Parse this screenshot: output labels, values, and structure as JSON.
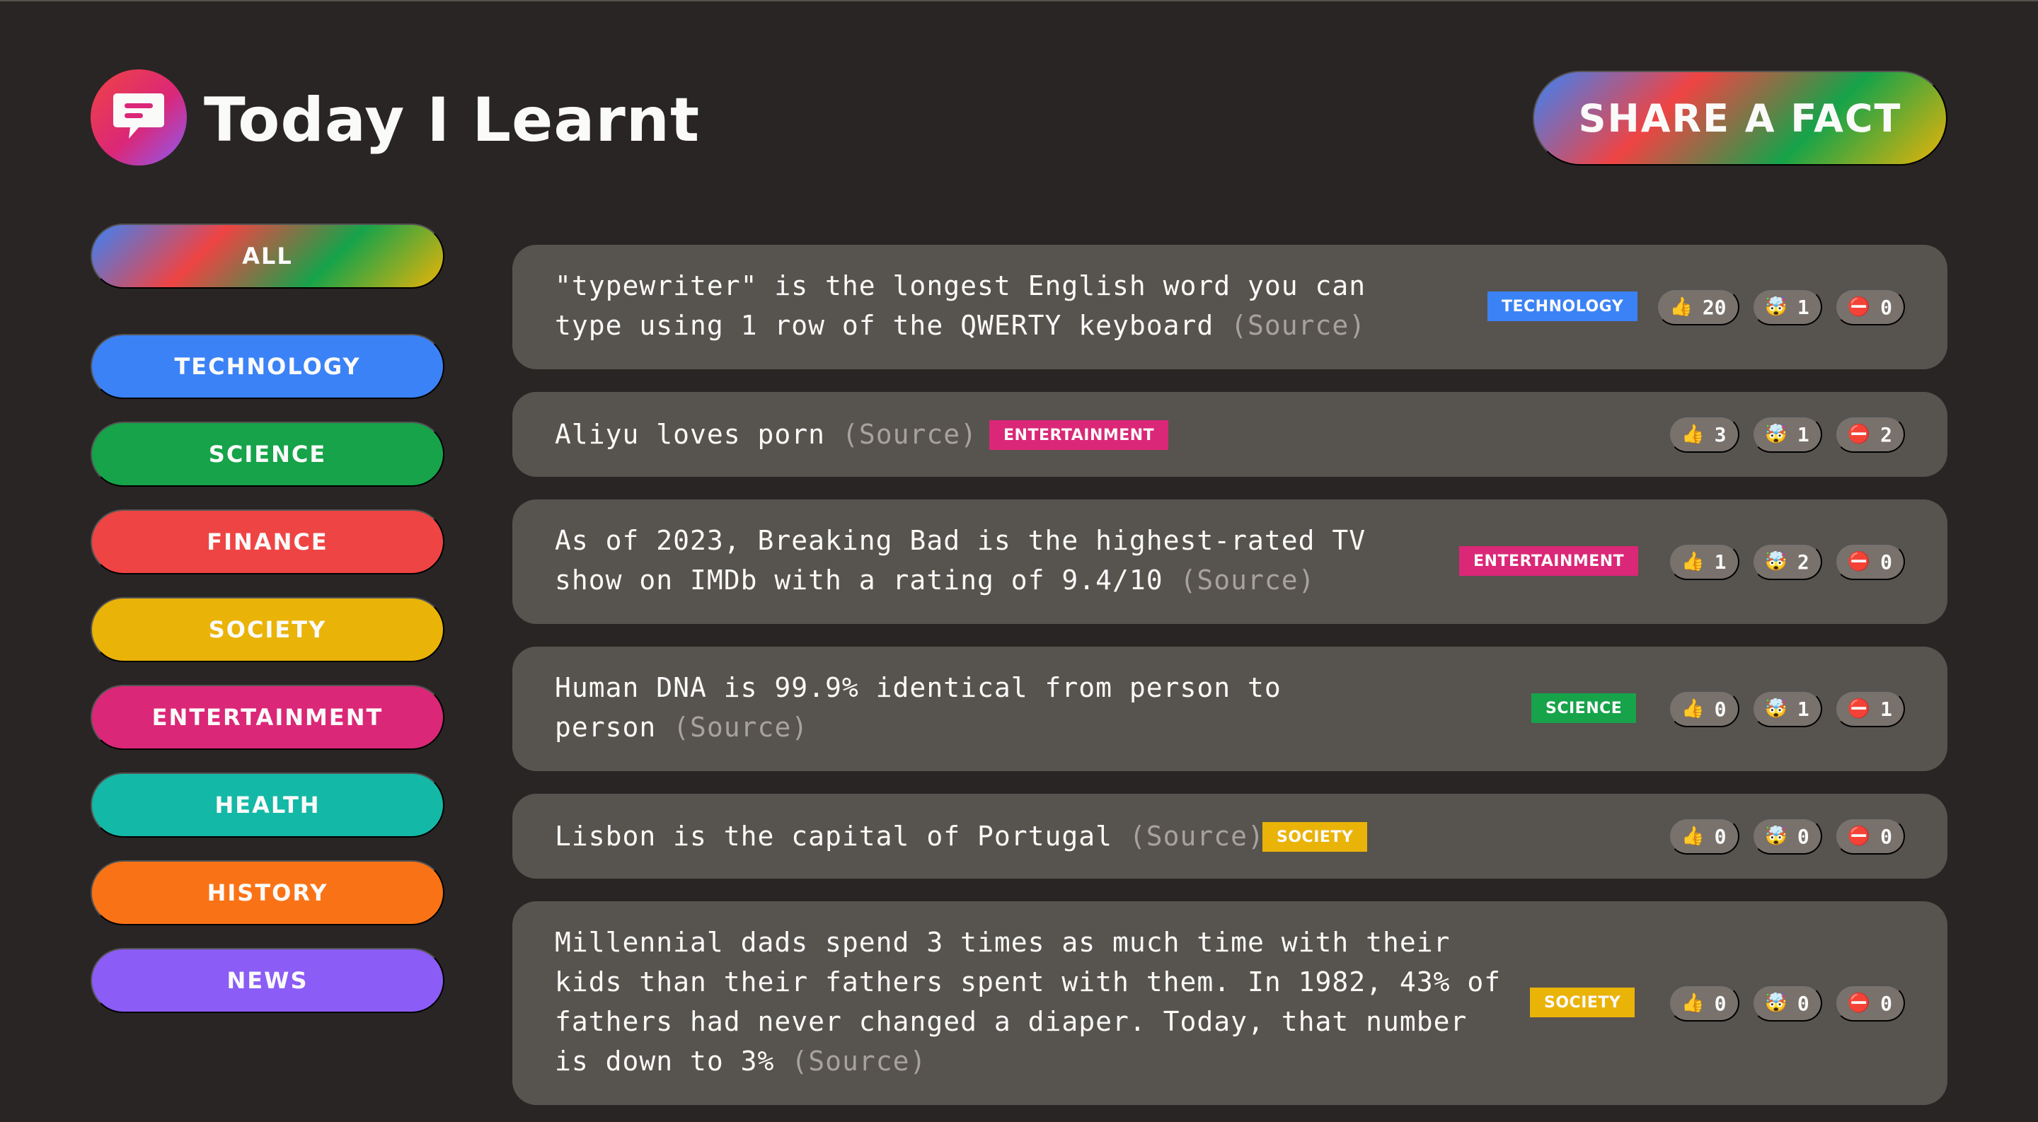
{
  "app": {
    "title": "Today I Learnt",
    "share_label": "Share a fact"
  },
  "colors": {
    "background": "#292524",
    "card": "#57534e",
    "technology": "#3b82f6",
    "science": "#16a34a",
    "finance": "#ef4444",
    "society": "#eab308",
    "entertainment": "#db2777",
    "health": "#14b8a6",
    "history": "#f97316",
    "news": "#8b5cf6"
  },
  "sidebar": {
    "items": [
      {
        "label": "All"
      },
      {
        "label": "Technology"
      },
      {
        "label": "Science"
      },
      {
        "label": "Finance"
      },
      {
        "label": "Society"
      },
      {
        "label": "Entertainment"
      },
      {
        "label": "Health"
      },
      {
        "label": "History"
      },
      {
        "label": "News"
      }
    ]
  },
  "facts": [
    {
      "text": "\"typewriter\" is the longest English word you can type using 1 row of the QWERTY keyboard",
      "source_label": "(Source)",
      "category": "Technology",
      "votes": {
        "interesting": "20",
        "mindblowing": "1",
        "false": "0"
      }
    },
    {
      "text": "Aliyu loves porn",
      "source_label": "(Source)",
      "category": "Entertainment",
      "votes": {
        "interesting": "3",
        "mindblowing": "1",
        "false": "2"
      }
    },
    {
      "text": "As of 2023, Breaking Bad is the highest-rated TV show on IMDb with a rating of 9.4/10",
      "source_label": "(Source)",
      "category": "Entertainment",
      "votes": {
        "interesting": "1",
        "mindblowing": "2",
        "false": "0"
      }
    },
    {
      "text": "Human DNA is 99.9% identical from person to person",
      "source_label": "(Source)",
      "category": "Science",
      "votes": {
        "interesting": "0",
        "mindblowing": "1",
        "false": "1"
      }
    },
    {
      "text": "Lisbon is the capital of Portugal",
      "source_label": "(Source)",
      "category": "Society",
      "votes": {
        "interesting": "0",
        "mindblowing": "0",
        "false": "0"
      }
    },
    {
      "text": "Millennial dads spend 3 times as much time with their kids than their fathers spent with them. In 1982, 43% of fathers had never changed a diaper. Today, that number is down to 3%",
      "source_label": "(Source)",
      "category": "Society",
      "votes": {
        "interesting": "0",
        "mindblowing": "0",
        "false": "0"
      }
    }
  ],
  "icons": {
    "logo": "speech-bubble-icon",
    "interesting": "thumbs-up-icon",
    "mindblowing": "mind-blown-icon",
    "false": "no-entry-icon"
  }
}
